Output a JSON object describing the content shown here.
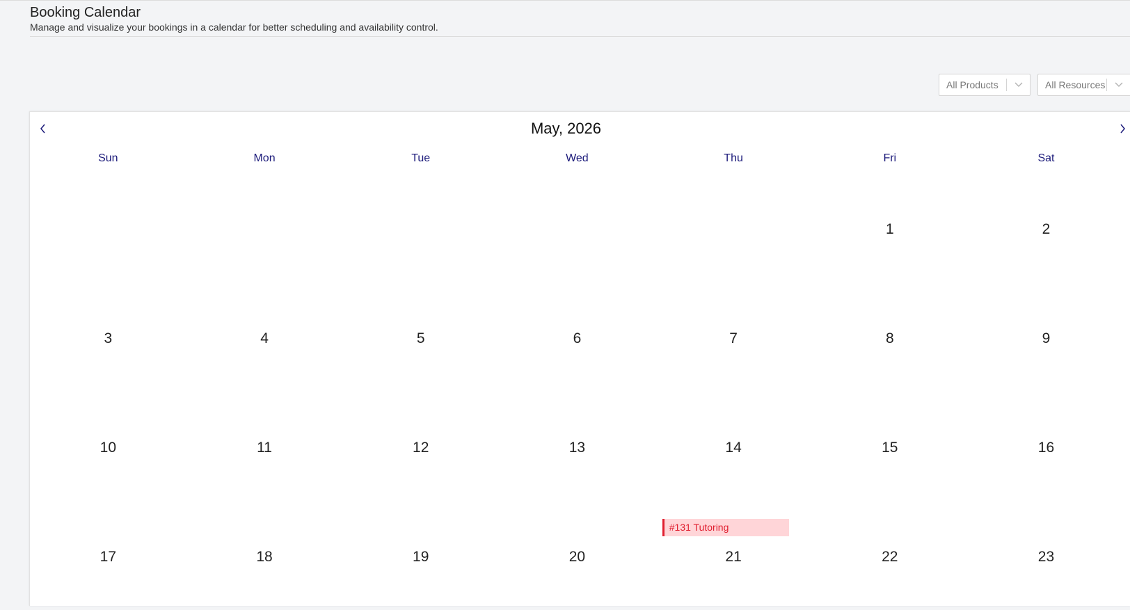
{
  "header": {
    "title": "Booking Calendar",
    "subtitle": "Manage and visualize your bookings in a calendar for better scheduling and availability control."
  },
  "filters": {
    "products": {
      "value": "All Products",
      "icon": "chevron-down-icon"
    },
    "resources": {
      "value": "All Resources",
      "icon": "chevron-down-icon"
    }
  },
  "calendar": {
    "month_title": "May, 2026",
    "prev_icon": "chevron-left-icon",
    "next_icon": "chevron-right-icon",
    "weekdays": [
      "Sun",
      "Mon",
      "Tue",
      "Wed",
      "Thu",
      "Fri",
      "Sat"
    ],
    "weeks": [
      [
        "",
        "",
        "",
        "",
        "",
        "1",
        "2"
      ],
      [
        "3",
        "4",
        "5",
        "6",
        "7",
        "8",
        "9"
      ],
      [
        "10",
        "11",
        "12",
        "13",
        "14",
        "15",
        "16"
      ],
      [
        "17",
        "18",
        "19",
        "20",
        "21",
        "22",
        "23"
      ]
    ],
    "events": [
      {
        "label": "#131 Tutoring",
        "day": "21"
      }
    ],
    "colors": {
      "weekday_text": "#1b1a7a",
      "event_background": "#ffd5d8",
      "event_text": "#e01e2f"
    }
  }
}
